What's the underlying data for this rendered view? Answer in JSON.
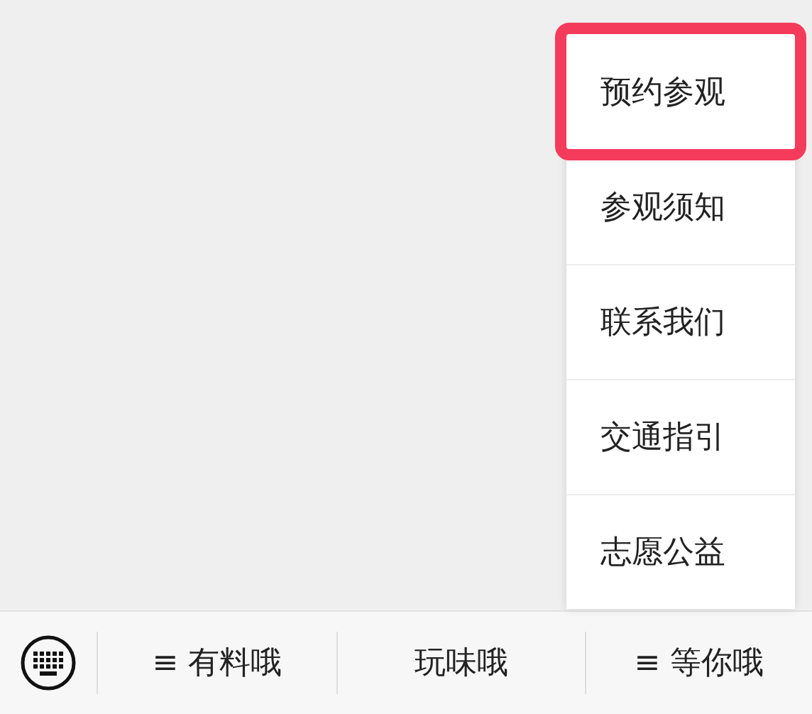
{
  "menu_bar": {
    "items": [
      {
        "label": "≡ 有料哦"
      },
      {
        "label": "玩味哦"
      },
      {
        "label": "≡ 等你哦"
      }
    ]
  },
  "popup_menu": {
    "items": [
      {
        "label": "预约参观",
        "highlighted": true
      },
      {
        "label": "参观须知",
        "highlighted": false
      },
      {
        "label": "联系我们",
        "highlighted": false
      },
      {
        "label": "交通指引",
        "highlighted": false
      },
      {
        "label": "志愿公益",
        "highlighted": false
      }
    ]
  }
}
